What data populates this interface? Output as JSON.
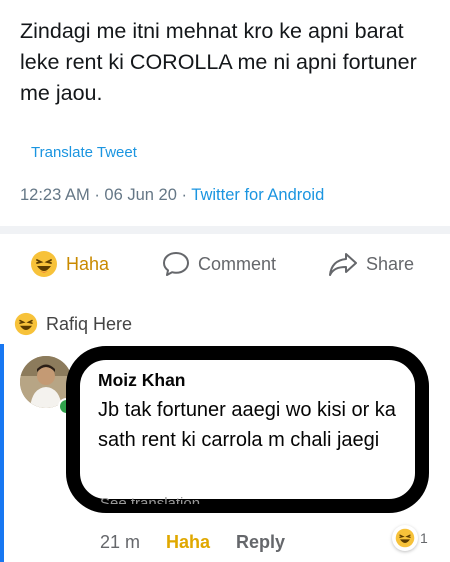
{
  "tweet": {
    "text": "Zindagi me itni mehnat kro ke apni barat leke rent ki COROLLA me ni apni fortuner me jaou.",
    "translate_label": "Translate Tweet",
    "time": "12:23 AM",
    "date": "06 Jun 20",
    "source": "Twitter for Android",
    "separator": "·"
  },
  "actions": {
    "haha_label": "Haha",
    "comment_label": "Comment",
    "share_label": "Share"
  },
  "reactor": {
    "name": "Rafiq Here"
  },
  "comment": {
    "author": "Moiz Khan",
    "text": "Jb tak fortuner aaegi wo kisi or ka sath rent ki carrola m chali jaegi",
    "see_translation": "See translation",
    "time": "21 m",
    "haha_label": "Haha",
    "reply_label": "Reply",
    "reaction_count": "1"
  },
  "colors": {
    "link_blue": "#1b95e0",
    "haha_yellow": "#e0a800",
    "online_green": "#31a24c",
    "thread_line": "#1877f2"
  },
  "icons": [
    "haha-emoji-icon",
    "comment-icon",
    "share-icon",
    "online-dot-icon"
  ]
}
